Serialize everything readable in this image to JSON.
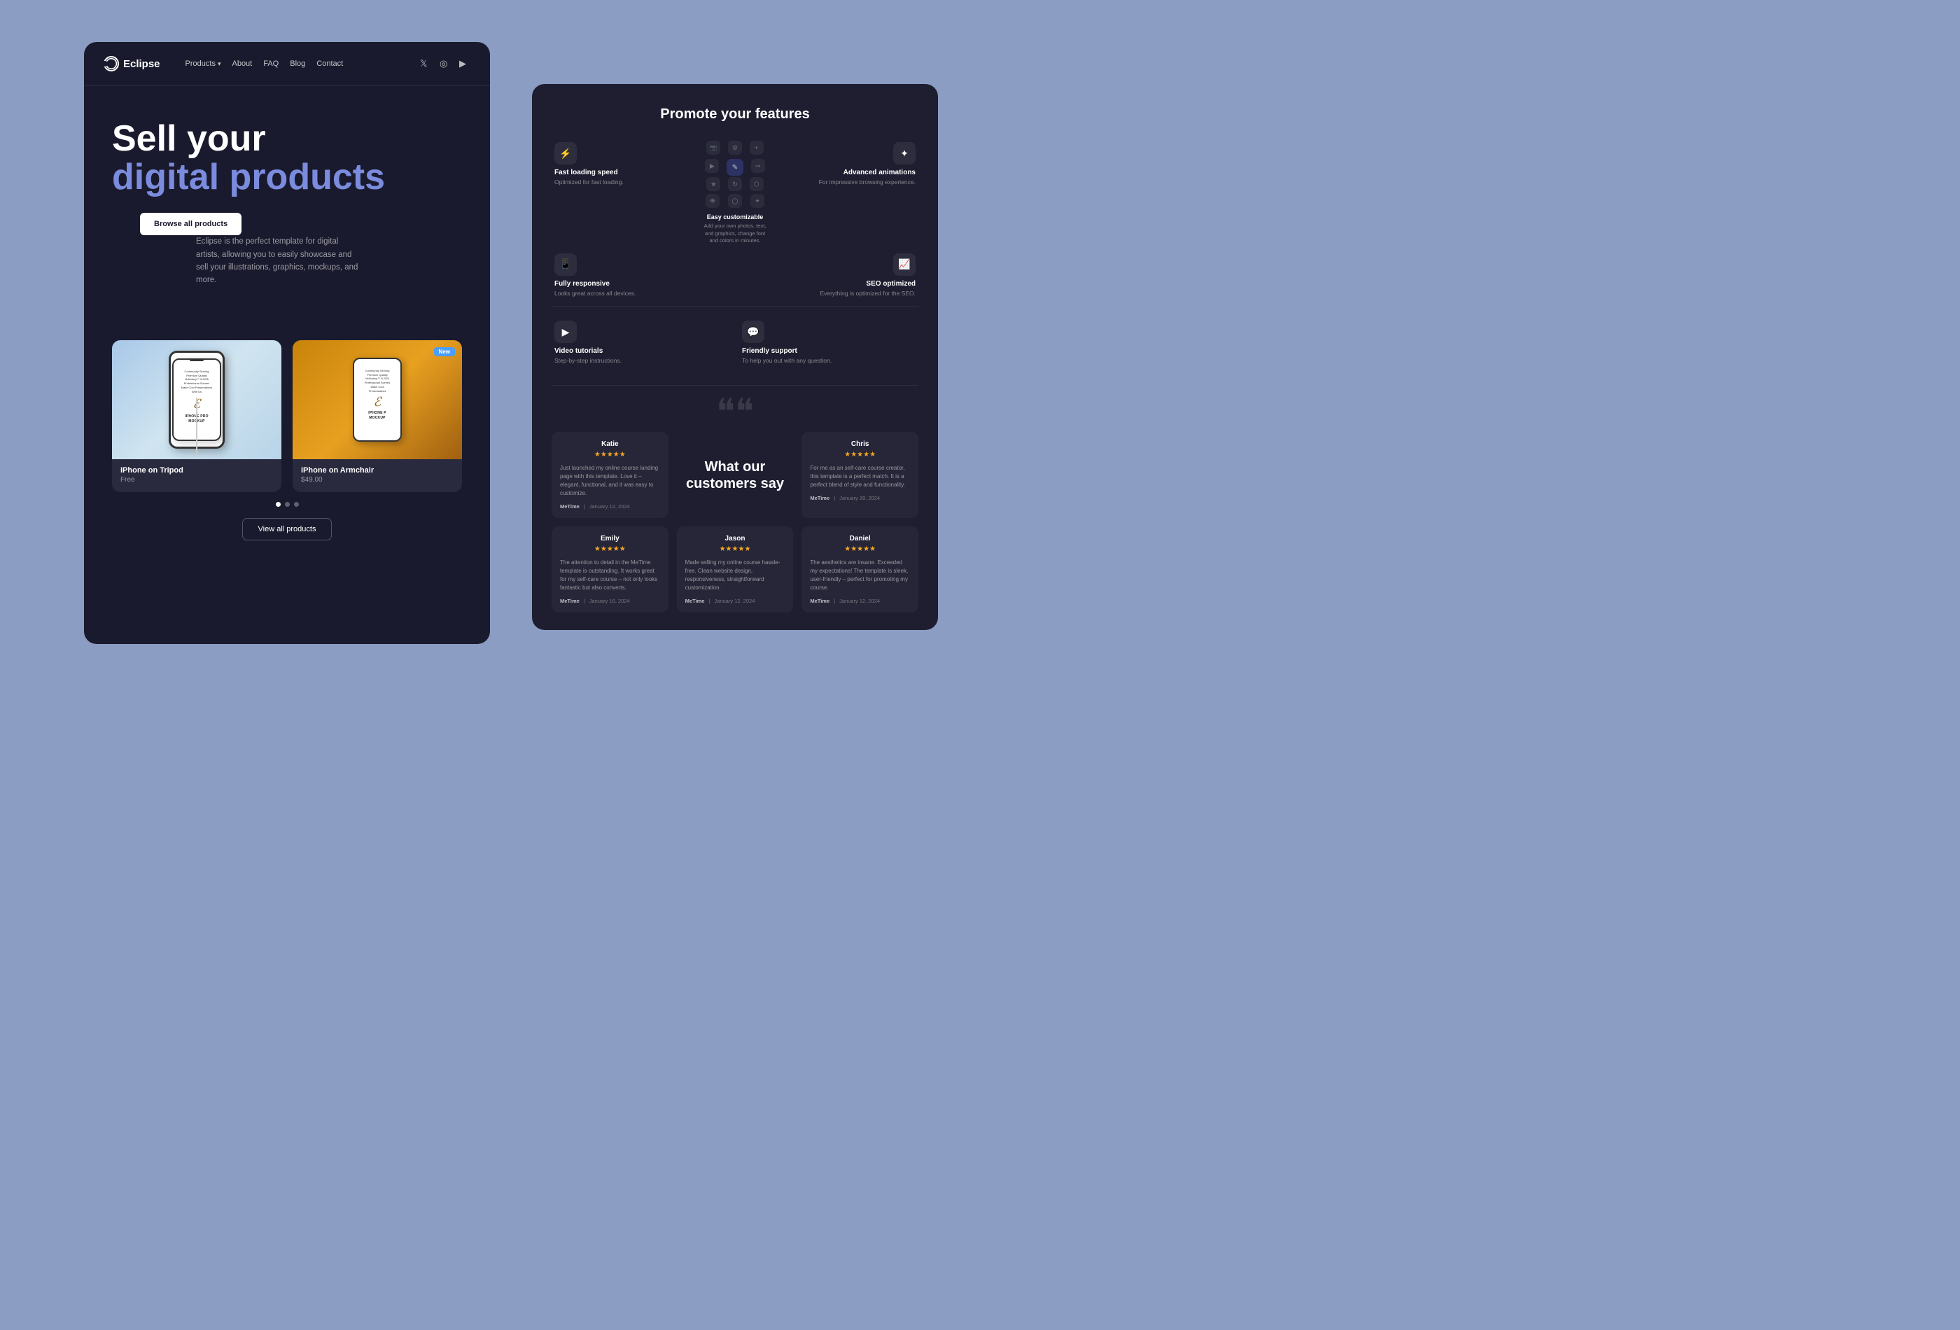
{
  "page": {
    "bg_color": "#8b9dc3"
  },
  "left_panel": {
    "nav": {
      "logo_text": "Eclipse",
      "links": [
        {
          "label": "Products",
          "has_dropdown": true
        },
        {
          "label": "About",
          "has_dropdown": false
        },
        {
          "label": "FAQ",
          "has_dropdown": false
        },
        {
          "label": "Blog",
          "has_dropdown": false
        },
        {
          "label": "Contact",
          "has_dropdown": false
        }
      ],
      "social_icons": [
        "twitter",
        "instagram",
        "youtube"
      ]
    },
    "hero": {
      "title_line1": "Sell your",
      "title_line2": "digital products",
      "description": "Eclipse is the perfect template for digital artists, allowing you to easily showcase and sell your illustrations, graphics, mockups, and more.",
      "cta_label": "Browse all products"
    },
    "products": [
      {
        "name": "iPhone on Tripod",
        "price": "Free",
        "badge": null,
        "img_type": "blue"
      },
      {
        "name": "iPhone on Armchair",
        "price": "$49.00",
        "badge": "New",
        "img_type": "orange"
      }
    ],
    "pagination_dots": 3,
    "active_dot": 0,
    "view_all_label": "View all products"
  },
  "right_panel": {
    "features": {
      "title": "Promote your features",
      "items": [
        {
          "icon": "⚡",
          "name": "Fast loading speed",
          "desc": "Optimized for fast loading.",
          "position": "top-left"
        },
        {
          "icon": "✎",
          "name": "Easy customizable",
          "desc": "Add your own photos, text, and graphics, change font and colors in minutes.",
          "position": "center"
        },
        {
          "icon": "✦",
          "name": "Advanced animations",
          "desc": "For impressive browsing experience.",
          "position": "top-right"
        },
        {
          "icon": "📱",
          "name": "Fully responsive",
          "desc": "Looks great across all devices.",
          "position": "mid-left"
        },
        {
          "icon": "📈",
          "name": "SEO optimized",
          "desc": "Everything is optimized for the SEO.",
          "position": "mid-right"
        },
        {
          "icon": "▶",
          "name": "Video tutorials",
          "desc": "Step-by-step instructions.",
          "position": "bottom-left"
        },
        {
          "icon": "💬",
          "name": "Friendly support",
          "desc": "To help you out with any question.",
          "position": "bottom-right"
        }
      ]
    },
    "testimonials": {
      "section_title_line1": "What our",
      "section_title_line2": "customers say",
      "quote_mark": "““",
      "items": [
        {
          "name": "Katie",
          "stars": 5,
          "text": "Just launched my online course landing page with this template. Love it – elegant, functional, and it was easy to customize.",
          "brand": "MeTime",
          "date": "January 12, 2024",
          "position": "top-left"
        },
        {
          "name": "Chris",
          "stars": 5,
          "text": "For me as an self-care course creator, this template is a perfect match. It is a perfect blend of style and functionality.",
          "brand": "MeTime",
          "date": "January 28, 2024",
          "position": "top-right"
        },
        {
          "name": "Emily",
          "stars": 5,
          "text": "The attention to detail in the MeTime template is outstanding. It works great for my self-care course – not only looks fantastic but also converts.",
          "brand": "MeTime",
          "date": "January 16, 2024",
          "position": "bottom-left"
        },
        {
          "name": "Jason",
          "stars": 5,
          "text": "Made selling my online course hassle-free. Clean website design, responsiveness, straightforward customization.",
          "brand": "MeTime",
          "date": "January 12, 2024",
          "position": "bottom-center"
        },
        {
          "name": "Daniel",
          "stars": 5,
          "text": "The aesthetics are insane. Exceeded my expectations! The template is sleek, user-friendly – perfect for promoting my course.",
          "brand": "MeTime",
          "date": "January 12, 2024",
          "position": "bottom-right"
        }
      ]
    }
  }
}
